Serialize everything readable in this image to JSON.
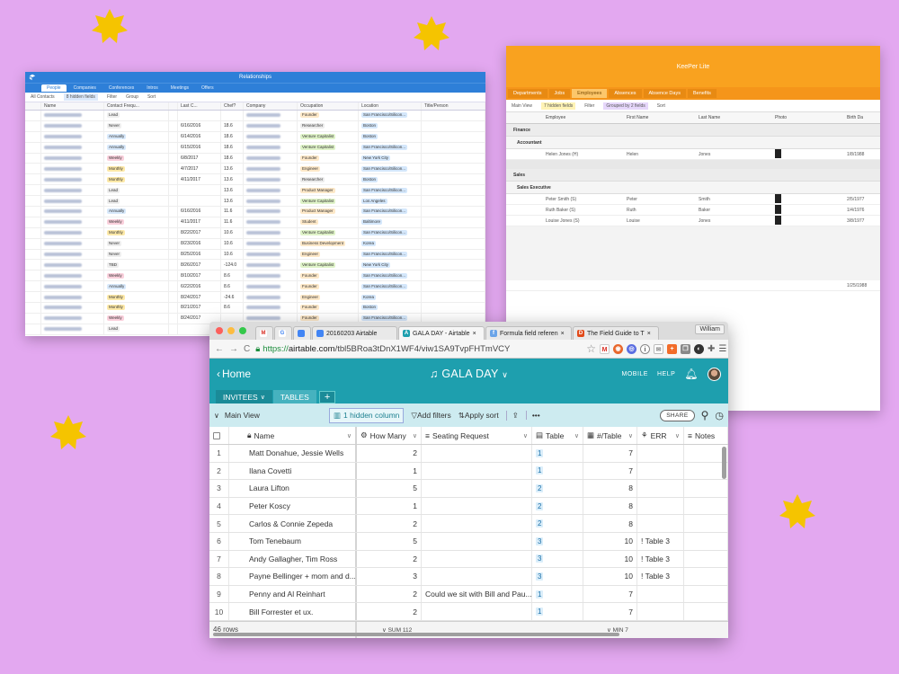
{
  "colors": {
    "background": "#e3a8f0",
    "star": "#f5c400",
    "airtable_teal": "#1e9fae",
    "relationships_blue": "#2e7fd8",
    "keeper_orange": "#f9a21f"
  },
  "relationships_window": {
    "title": "Relationships",
    "tabs": [
      "People",
      "Companies",
      "Conferences",
      "Intros",
      "Meetings",
      "Offers"
    ],
    "toolbar": [
      "All Contacts",
      "8 hidden fields",
      "Filter",
      "Group",
      "Sort"
    ],
    "headers": [
      "Name",
      "Contact Frequ...",
      "Last C...",
      "Chef?",
      "Company",
      "Occupation",
      "Location",
      "Title/Person"
    ],
    "rows": [
      {
        "freq": "Lead",
        "date": "",
        "chef": "",
        "occ": "Founder",
        "loc": "San Francisco/Silicon..."
      },
      {
        "freq": "Never",
        "date": "6/16/2016",
        "chef": "18.6",
        "occ": "Researcher",
        "loc": "Boston"
      },
      {
        "freq": "Annually",
        "date": "6/14/2016",
        "chef": "18.6",
        "occ": "Venture Capitalist",
        "loc": "Boston"
      },
      {
        "freq": "Annually",
        "date": "6/15/2016",
        "chef": "18.6",
        "occ": "Venture Capitalist",
        "loc": "San Francisco/Silicon..."
      },
      {
        "freq": "Weekly",
        "date": "6/8/2017",
        "chef": "18.6",
        "occ": "Founder",
        "loc": "New York City"
      },
      {
        "freq": "Monthly",
        "date": "4/7/2017",
        "chef": "13.6",
        "occ": "Engineer",
        "loc": "San Francisco/Silicon..."
      },
      {
        "freq": "Monthly",
        "date": "4/11/2017",
        "chef": "13.6",
        "occ": "Researcher",
        "loc": "Boston"
      },
      {
        "freq": "Lead",
        "date": "",
        "chef": "13.6",
        "occ": "Product Manager",
        "loc": "San Francisco/Silicon..."
      },
      {
        "freq": "Lead",
        "date": "",
        "chef": "13.6",
        "occ": "Venture Capitalist",
        "loc": "Los Angeles"
      },
      {
        "freq": "Annually",
        "date": "6/16/2016",
        "chef": "11.6",
        "occ": "Product Manager",
        "loc": "San Francisco/Silicon..."
      },
      {
        "freq": "Weekly",
        "date": "4/11/2017",
        "chef": "11.6",
        "occ": "Student",
        "loc": "Baltimore"
      },
      {
        "freq": "Monthly",
        "date": "8/22/2017",
        "chef": "10.6",
        "occ": "Venture Capitalist",
        "loc": "San Francisco/Silicon..."
      },
      {
        "freq": "Never",
        "date": "8/23/2016",
        "chef": "10.6",
        "occ": "Business Development",
        "loc": "Korea"
      },
      {
        "freq": "Never",
        "date": "8/25/2016",
        "chef": "10.6",
        "occ": "Engineer",
        "loc": "San Francisco/Silicon..."
      },
      {
        "freq": "TBD",
        "date": "8/26/2017",
        "chef": "-124.0",
        "occ": "Venture Capitalist",
        "loc": "New York City"
      },
      {
        "freq": "Weekly",
        "date": "8/10/2017",
        "chef": "8.6",
        "occ": "Founder",
        "loc": "San Francisco/Silicon..."
      },
      {
        "freq": "Annually",
        "date": "6/22/2016",
        "chef": "8.6",
        "occ": "Founder",
        "loc": "San Francisco/Silicon..."
      },
      {
        "freq": "Monthly",
        "date": "8/24/2017",
        "chef": "-24.6",
        "occ": "Engineer",
        "loc": "Korea"
      },
      {
        "freq": "Monthly",
        "date": "8/21/2017",
        "chef": "8.6",
        "occ": "Founder",
        "loc": "Boston"
      },
      {
        "freq": "Weekly",
        "date": "8/24/2017",
        "chef": "",
        "occ": "Founder",
        "loc": "San Francisco/Silicon..."
      },
      {
        "freq": "Lead",
        "date": "",
        "chef": "",
        "occ": "",
        "loc": ""
      }
    ]
  },
  "keeper_window": {
    "title": "KeePer Lite",
    "tabs": [
      "Departments",
      "Jobs",
      "Employees",
      "Absences",
      "Absence Days",
      "Benefits"
    ],
    "toolbar": [
      "Main View",
      "7 hidden fields",
      "Filter",
      "Grouped by 2 fields",
      "Sort"
    ],
    "headers": [
      "Employee",
      "First Name",
      "Last Name",
      "Photo",
      "Birth Da"
    ],
    "group1": "Finance",
    "group1_sub": "Accountant",
    "group1_rows": [
      {
        "emp": "Helen Jones (H)",
        "first": "Helen",
        "last": "Jones",
        "date": "1/8/1988"
      }
    ],
    "group2": "Sales",
    "group2_sub": "Sales Executive",
    "group2_rows": [
      {
        "emp": "Peter Smith (S)",
        "first": "Peter",
        "last": "Smith",
        "date": "2/5/1977"
      },
      {
        "emp": "Ruth Baker (S)",
        "first": "Ruth",
        "last": "Baker",
        "date": "1/4/1976"
      },
      {
        "emp": "Louise Jones (S)",
        "first": "Louise",
        "last": "Jones",
        "date": "3/8/1977"
      }
    ],
    "last_date": "1/25/1988"
  },
  "browser": {
    "tabs": [
      {
        "label": "20160203 Airtable",
        "active": false
      },
      {
        "label": "GALA DAY - Airtable",
        "active": true
      },
      {
        "label": "Formula field referen",
        "active": false
      },
      {
        "label": "The Field Guide to T",
        "active": false
      }
    ],
    "user": "William",
    "url_scheme": "https://",
    "url_domain": "airtable.com",
    "url_path": "/tbl5BRoa3tDnX1WF4/viw1SA9TvpFHTmVCY"
  },
  "airtable": {
    "home": "Home",
    "base_name": "GALA DAY",
    "mobile": "MOBILE",
    "help": "HELP",
    "tabs": [
      "INVITEES",
      "TABLES"
    ],
    "view": "Main View",
    "hidden": "1 hidden column",
    "filter": "Add filters",
    "sort": "Apply sort",
    "share": "SHARE",
    "columns": [
      "Name",
      "How Many",
      "Seating Request",
      "Table",
      "#/Table",
      "ERR",
      "Notes"
    ],
    "rows": [
      {
        "n": "1",
        "name": "Matt Donahue, Jessie Wells",
        "how": "2",
        "seat": "",
        "table": "1",
        "per": "7",
        "err": ""
      },
      {
        "n": "2",
        "name": "Ilana Covetti",
        "how": "1",
        "seat": "",
        "table": "1",
        "per": "7",
        "err": ""
      },
      {
        "n": "3",
        "name": "Laura Lifton",
        "how": "5",
        "seat": "",
        "table": "2",
        "per": "8",
        "err": ""
      },
      {
        "n": "4",
        "name": "Peter Koscy",
        "how": "1",
        "seat": "",
        "table": "2",
        "per": "8",
        "err": ""
      },
      {
        "n": "5",
        "name": "Carlos & Connie Zepeda",
        "how": "2",
        "seat": "",
        "table": "2",
        "per": "8",
        "err": ""
      },
      {
        "n": "6",
        "name": "Tom Tenebaum",
        "how": "5",
        "seat": "",
        "table": "3",
        "per": "10",
        "err": "! Table 3"
      },
      {
        "n": "7",
        "name": "Andy Gallagher, Tim Ross",
        "how": "2",
        "seat": "",
        "table": "3",
        "per": "10",
        "err": "! Table 3"
      },
      {
        "n": "8",
        "name": "Payne Bellinger + mom and d...",
        "how": "3",
        "seat": "",
        "table": "3",
        "per": "10",
        "err": "! Table 3"
      },
      {
        "n": "9",
        "name": "Penny and Al Reinhart",
        "how": "2",
        "seat": "Could we sit with Bill and Pau...",
        "table": "1",
        "per": "7",
        "err": ""
      },
      {
        "n": "10",
        "name": "Bill Forrester et ux.",
        "how": "2",
        "seat": "",
        "table": "1",
        "per": "7",
        "err": ""
      }
    ],
    "footer_rows": "46 rows",
    "footer_sum": "SUM 112",
    "footer_min": "MIN 7"
  }
}
